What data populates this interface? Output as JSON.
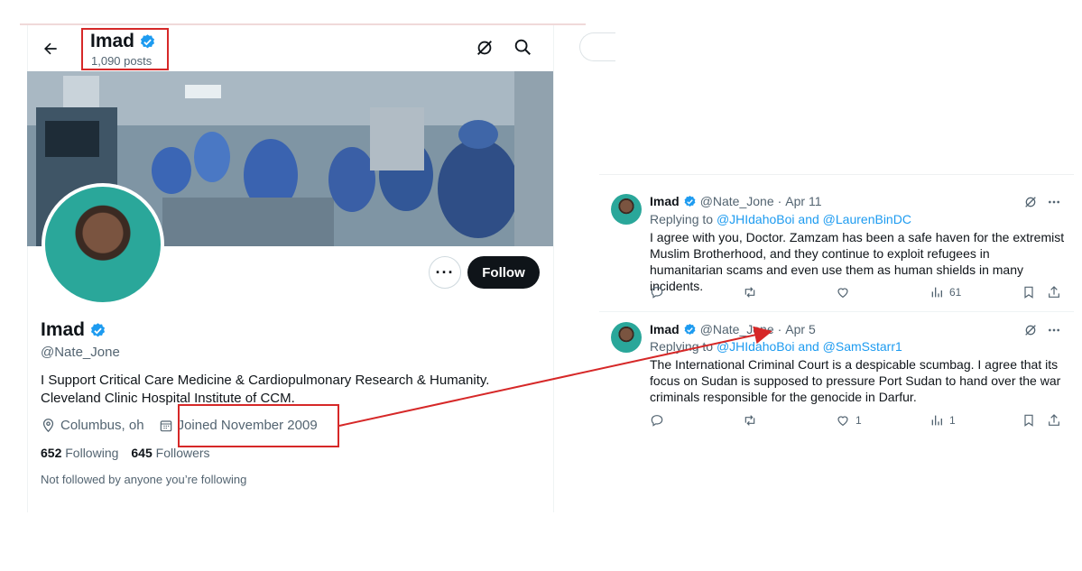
{
  "profile_header": {
    "name": "Imad",
    "posts": "1,090 posts"
  },
  "profile": {
    "name": "Imad",
    "handle": "@Nate_Jone",
    "more_label": "···",
    "follow_label": "Follow",
    "bio_line1": "I Support Critical Care Medicine & Cardiopulmonary Research & Humanity.",
    "bio_line2": "Cleveland Clinic Hospital Institute of CCM.",
    "location": "Columbus, oh",
    "joined": "Joined November 2009",
    "following_count": "652",
    "following_label": "Following",
    "followers_count": "645",
    "followers_label": "Followers",
    "note": "Not followed by anyone you’re following"
  },
  "tweets": [
    {
      "name": "Imad",
      "handle": "@Nate_Jone",
      "dot": "·",
      "date": "Apr 11",
      "replying_prefix": "Replying to",
      "reply_user1": "@JHIdahoBoi",
      "reply_and": "and",
      "reply_user2": "@LaurenBinDC",
      "text": "I agree with you, Doctor. Zamzam has been a safe haven for the extremist Muslim Brotherhood, and they continue to exploit refugees in humanitarian scams and even use them as human shields in many incidents.",
      "likes": "",
      "views": "61"
    },
    {
      "name": "Imad",
      "handle": "@Nate_Jone",
      "dot": "·",
      "date": "Apr 5",
      "replying_prefix": "Replying to",
      "reply_user1": "@JHIdahoBoi",
      "reply_and": "and",
      "reply_user2": "@SamSstarr1",
      "text": "The International Criminal Court is a despicable scumbag. I agree that its focus on Sudan is supposed to pressure Port Sudan to hand over the war criminals responsible for the genocide in Darfur.",
      "likes": "1",
      "views": "1"
    }
  ],
  "colors": {
    "accent": "#1d9bf0",
    "annotation": "#d62828",
    "follow_button": "#0f1419"
  }
}
